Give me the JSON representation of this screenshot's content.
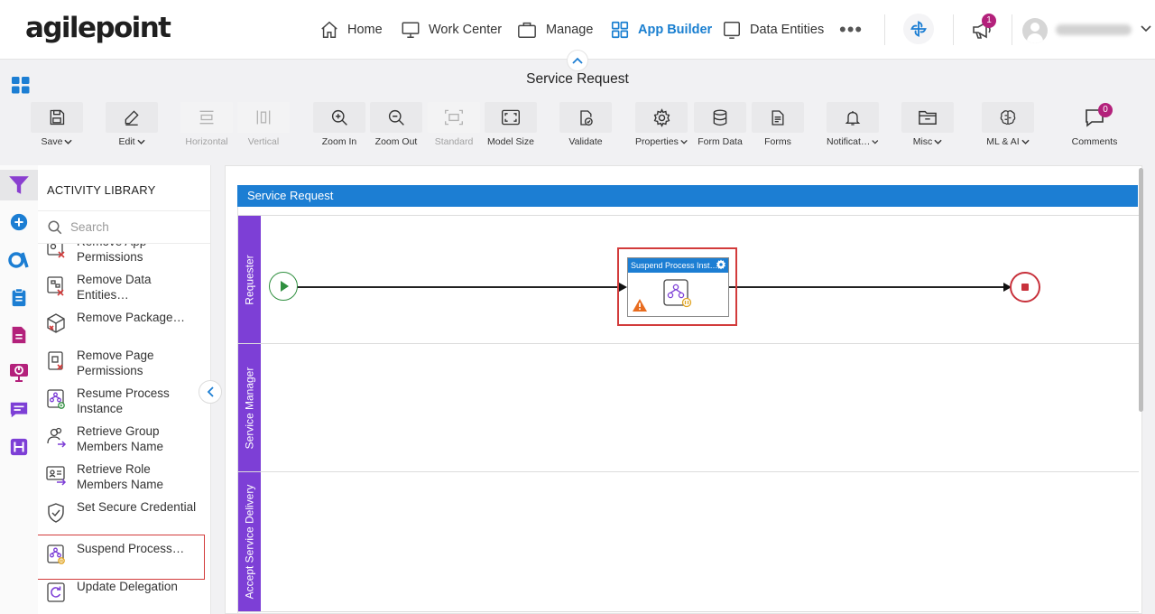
{
  "brand": {
    "logo_text": "agilepoint"
  },
  "nav": {
    "items": [
      {
        "label": "Home",
        "icon": "home-icon"
      },
      {
        "label": "Work Center",
        "icon": "monitor-icon"
      },
      {
        "label": "Manage",
        "icon": "briefcase-icon"
      },
      {
        "label": "App Builder",
        "icon": "grid-apps-icon",
        "active": true
      },
      {
        "label": "Data Entities",
        "icon": "square-icon"
      }
    ],
    "more": "•••",
    "notification_count": "1"
  },
  "header": {
    "title": "Service Request"
  },
  "toolbar": {
    "buttons": [
      {
        "label": "Save",
        "has_dropdown": true,
        "disabled": false
      },
      {
        "label": "Edit",
        "has_dropdown": true,
        "disabled": false
      },
      {
        "label": "Horizontal",
        "has_dropdown": false,
        "disabled": true
      },
      {
        "label": "Vertical",
        "has_dropdown": false,
        "disabled": true
      },
      {
        "label": "Zoom In",
        "has_dropdown": false,
        "disabled": false
      },
      {
        "label": "Zoom Out",
        "has_dropdown": false,
        "disabled": false
      },
      {
        "label": "Standard",
        "has_dropdown": false,
        "disabled": true
      },
      {
        "label": "Model Size",
        "has_dropdown": false,
        "disabled": false
      },
      {
        "label": "Validate",
        "has_dropdown": false,
        "disabled": false
      },
      {
        "label": "Properties",
        "has_dropdown": true,
        "disabled": false
      },
      {
        "label": "Form Data",
        "has_dropdown": false,
        "disabled": false
      },
      {
        "label": "Forms",
        "has_dropdown": false,
        "disabled": false
      },
      {
        "label": "Notificat…",
        "has_dropdown": true,
        "disabled": false
      },
      {
        "label": "Misc",
        "has_dropdown": true,
        "disabled": false
      },
      {
        "label": "ML & AI",
        "has_dropdown": true,
        "disabled": false
      },
      {
        "label": "Comments",
        "has_dropdown": false,
        "disabled": false
      }
    ],
    "comments_count": "0"
  },
  "library": {
    "title": "ACTIVITY LIBRARY",
    "search_placeholder": "Search",
    "items": [
      {
        "label": "Remove App Permissions",
        "icon": "remove-app-permissions-icon"
      },
      {
        "label": "Remove Data Entities…",
        "icon": "remove-data-entities-icon"
      },
      {
        "label": "Remove Package…",
        "icon": "remove-package-icon"
      },
      {
        "label": "Remove Page Permissions",
        "icon": "remove-page-permissions-icon"
      },
      {
        "label": "Resume Process Instance",
        "icon": "resume-process-icon"
      },
      {
        "label": "Retrieve Group Members Name",
        "icon": "retrieve-group-members-icon"
      },
      {
        "label": "Retrieve Role Members Name",
        "icon": "retrieve-role-members-icon"
      },
      {
        "label": "Set Secure Credential",
        "icon": "secure-credential-icon"
      },
      {
        "label": "Suspend Process…",
        "icon": "suspend-process-icon",
        "selected": true
      },
      {
        "label": "Update Delegation",
        "icon": "update-delegation-icon"
      }
    ]
  },
  "canvas": {
    "pool_title": "Service Request",
    "lanes": [
      "Requester",
      "Service Manager",
      "Accept Service Delivery"
    ],
    "task": {
      "title": "Suspend Process Inst…",
      "has_warning": true
    }
  },
  "colors": {
    "accent_blue": "#1c7ed3",
    "lane_purple": "#7d3fd6",
    "highlight_red": "#d23b3b",
    "badge_magenta": "#b3217b",
    "start_green": "#2f8f3f",
    "end_red": "#c8323c"
  }
}
